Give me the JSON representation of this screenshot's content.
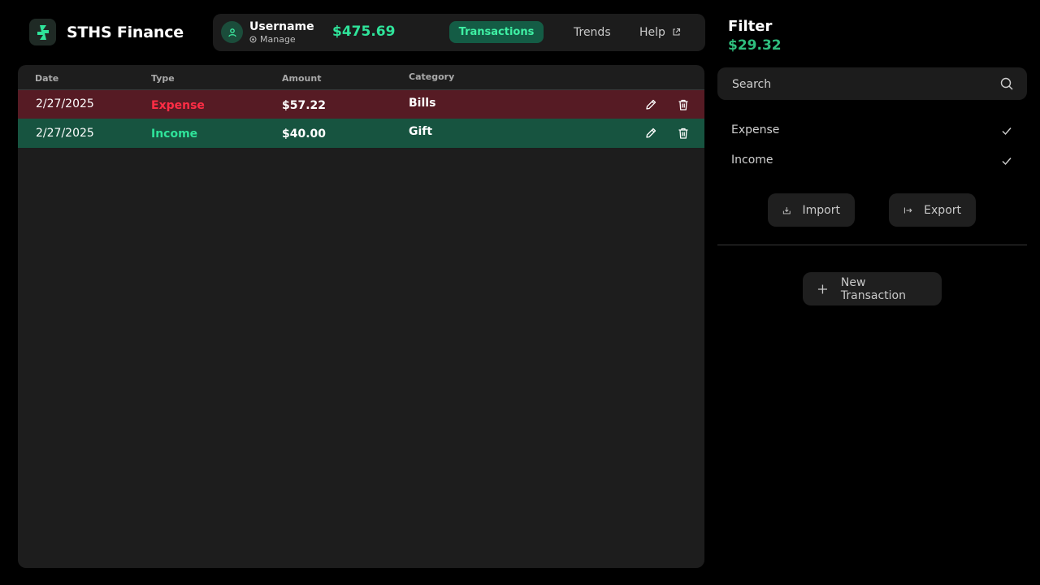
{
  "brand": {
    "title": "STHS Finance"
  },
  "user": {
    "name": "Username",
    "manage_label": "Manage"
  },
  "balance": "$475.69",
  "nav": {
    "tabs": [
      {
        "label": "Transactions",
        "active": true
      },
      {
        "label": "Trends",
        "active": false
      },
      {
        "label": "Help",
        "active": false
      }
    ]
  },
  "table": {
    "columns": [
      "Date",
      "Type",
      "Amount",
      "Category"
    ],
    "rows": [
      {
        "date": "2/27/2025",
        "type": "Expense",
        "amount": "$57.22",
        "category": "Bills",
        "type_color": "#ff2d45"
      },
      {
        "date": "2/27/2025",
        "type": "Income",
        "amount": "$40.00",
        "category": "Gift",
        "type_color": "#2fe39a"
      }
    ]
  },
  "sidebar": {
    "filter_title": "Filter",
    "filter_amount": "$29.32",
    "search": {
      "placeholder": "Search"
    },
    "options": [
      {
        "label": "Expense",
        "checked": true
      },
      {
        "label": "Income",
        "checked": true
      }
    ],
    "import_label": "Import",
    "export_label": "Export",
    "new_transaction_label": "New Transaction"
  },
  "colors": {
    "accent": "#2fe39a",
    "expense_row": "#561b24",
    "income_row": "#175440"
  }
}
